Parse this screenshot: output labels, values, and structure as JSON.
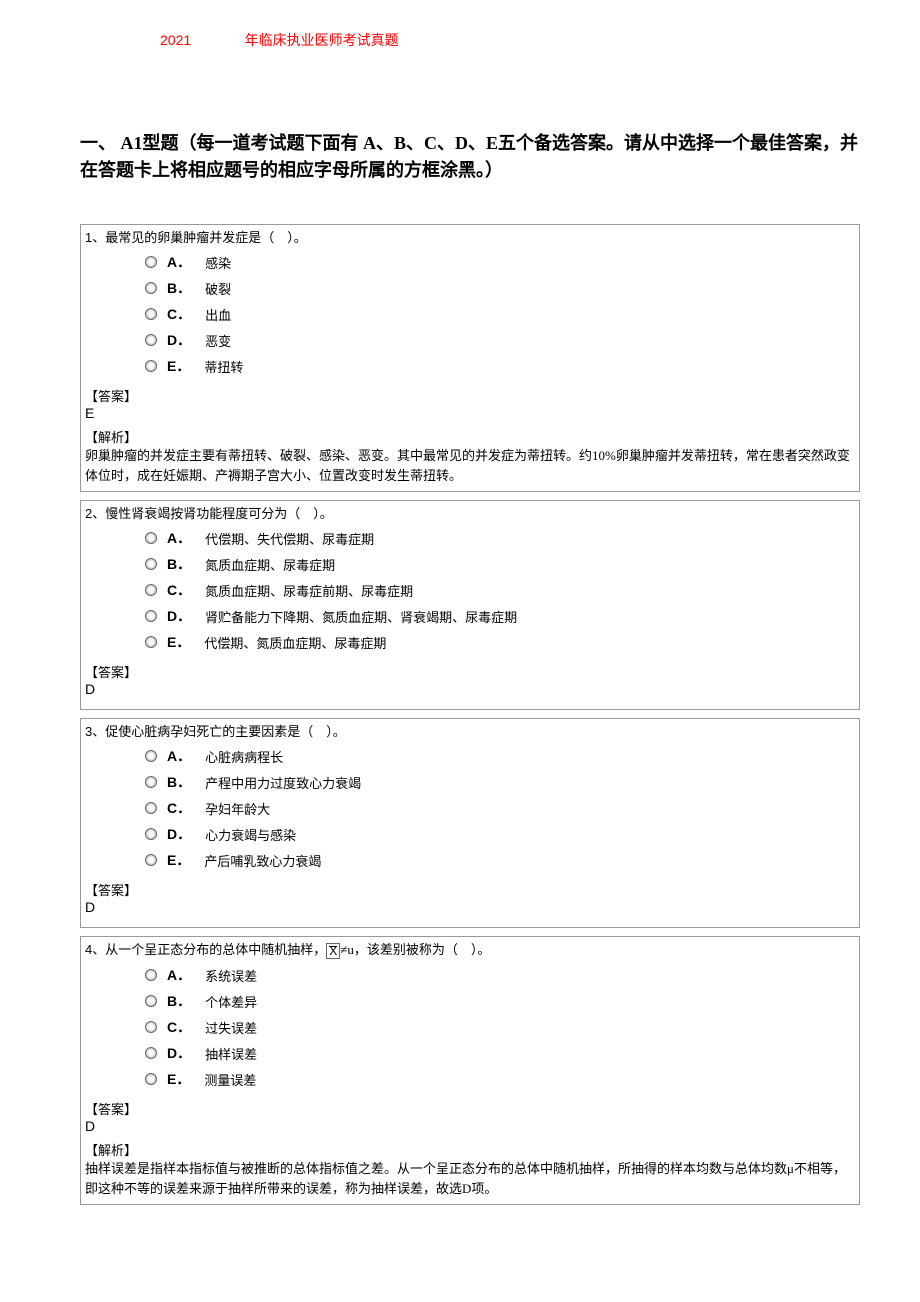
{
  "header": {
    "year": "2021",
    "title": "年临床执业医师考试真题"
  },
  "section": {
    "title": "一、 A1型题（每一道考试题下面有 A、B、C、D、E五个备选答案。请从中选择一个最佳答案，并在答题卡上将相应题号的相应字母所属的方框涂黑。）"
  },
  "labels": {
    "answer": "【答案】",
    "analysis": "【解析】"
  },
  "questions": [
    {
      "num": "1",
      "stem_prefix": "、最常见的卵巢肿瘤并发症是（",
      "stem_suffix": "）。",
      "options": [
        {
          "label": "A．",
          "text": "感染"
        },
        {
          "label": "B．",
          "text": "破裂"
        },
        {
          "label": "C．",
          "text": "出血"
        },
        {
          "label": "D．",
          "text": "恶变"
        },
        {
          "label": "E．",
          "text": "蒂扭转"
        }
      ],
      "answer": "E",
      "analysis": "卵巢肿瘤的并发症主要有蒂扭转、破裂、感染、恶变。其中最常见的并发症为蒂扭转。约10%卵巢肿瘤并发蒂扭转，常在患者突然政变体位时，成在妊娠期、产褥期子宫大小、位置改变时发生蒂扭转。"
    },
    {
      "num": "2",
      "stem_prefix": "、慢性肾衰竭按肾功能程度可分为（",
      "stem_suffix": "）。",
      "options": [
        {
          "label": "A．",
          "text": "代偿期、失代偿期、尿毒症期"
        },
        {
          "label": "B．",
          "text": "氮质血症期、尿毒症期"
        },
        {
          "label": "C．",
          "text": "氮质血症期、尿毒症前期、尿毒症期"
        },
        {
          "label": "D．",
          "text": "肾贮备能力下降期、氮质血症期、肾衰竭期、尿毒症期"
        },
        {
          "label": "E．",
          "text": "代偿期、氮质血症期、尿毒症期"
        }
      ],
      "answer": "D",
      "analysis": ""
    },
    {
      "num": "3",
      "stem_prefix": "、促使心脏病孕妇死亡的主要因素是（",
      "stem_suffix": "）。",
      "options": [
        {
          "label": "A．",
          "text": "心脏病病程长"
        },
        {
          "label": "B．",
          "text": "产程中用力过度致心力衰竭"
        },
        {
          "label": "C．",
          "text": "孕妇年龄大"
        },
        {
          "label": "D．",
          "text": "心力衰竭与感染"
        },
        {
          "label": "E．",
          "text": "产后哺乳致心力衰竭"
        }
      ],
      "answer": "D",
      "analysis": ""
    },
    {
      "num": "4",
      "stem_prefix": "、从一个呈正态分布的总体中随机抽样，",
      "stem_mid": "≠u，该差别被称为（",
      "stem_suffix": "）。",
      "has_xbar": true,
      "xbar": "X",
      "options": [
        {
          "label": "A．",
          "text": "系统误差"
        },
        {
          "label": "B．",
          "text": "个体差异"
        },
        {
          "label": "C．",
          "text": "过失误差"
        },
        {
          "label": "D．",
          "text": "抽样误差"
        },
        {
          "label": "E．",
          "text": "测量误差"
        }
      ],
      "answer": "D",
      "analysis": "抽样误差是指样本指标值与被推断的总体指标值之差。从一个呈正态分布的总体中随机抽样，所抽得的样本均数与总体均数μ不相等，即这种不等的误差来源于抽样所带来的误差，称为抽样误差，故选D项。"
    }
  ]
}
